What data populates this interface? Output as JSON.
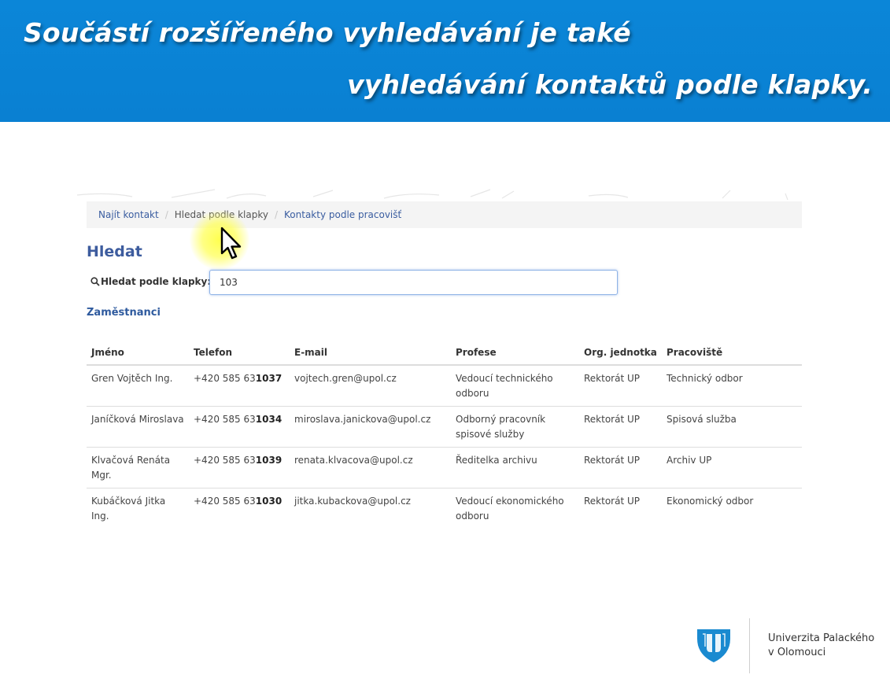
{
  "banner": {
    "line1": "Součástí rozšířeného vyhledávání je také",
    "line2": "vyhledávání kontaktů podle klapky."
  },
  "breadcrumb": {
    "items": [
      {
        "label": "Najít kontakt"
      },
      {
        "label": "Hledat podle klapky"
      },
      {
        "label": "Kontakty podle pracovišť"
      }
    ],
    "active_index": 1
  },
  "search": {
    "heading": "Hledat",
    "label": "Hledat podle klapky:",
    "value": "103",
    "icon": "search-icon"
  },
  "results": {
    "section_title": "Zaměstnanci",
    "columns": [
      "Jméno",
      "Telefon",
      "E-mail",
      "Profese",
      "Org. jednotka",
      "Pracoviště"
    ],
    "rows": [
      {
        "name": "Gren Vojtěch Ing.",
        "phone_prefix": "+420 585 63",
        "phone_ext": "1037",
        "email": "vojtech.gren@upol.cz",
        "profession": "Vedoucí technického odboru",
        "org": "Rektorát UP",
        "workplace": "Technický odbor"
      },
      {
        "name": "Janíčková Miroslava",
        "phone_prefix": "+420 585 63",
        "phone_ext": "1034",
        "email": "miroslava.janickova@upol.cz",
        "profession": "Odborný pracovník spisové služby",
        "org": "Rektorát UP",
        "workplace": "Spisová služba"
      },
      {
        "name": "Klvačová Renáta Mgr.",
        "phone_prefix": "+420 585 63",
        "phone_ext": "1039",
        "email": "renata.klvacova@upol.cz",
        "profession": "Ředitelka archivu",
        "org": "Rektorát UP",
        "workplace": "Archiv UP"
      },
      {
        "name": "Kubáčková Jitka Ing.",
        "phone_prefix": "+420 585 63",
        "phone_ext": "1030",
        "email": "jitka.kubackova@upol.cz",
        "profession": "Vedoucí ekonomického odboru",
        "org": "Rektorát UP",
        "workplace": "Ekonomický odbor"
      }
    ]
  },
  "logo": {
    "line1": "Univerzita Palackého",
    "line2": "v Olomouci",
    "icon": "university-shield-icon"
  },
  "colors": {
    "banner": "#0a82d4",
    "link": "#3a5da0",
    "heading": "#3d5c9e",
    "logo_blue": "#1a8ad0"
  }
}
